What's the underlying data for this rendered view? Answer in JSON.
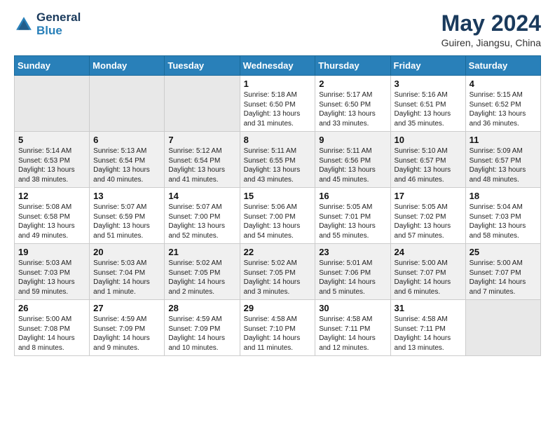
{
  "header": {
    "logo_line1": "General",
    "logo_line2": "Blue",
    "month": "May 2024",
    "location": "Guiren, Jiangsu, China"
  },
  "days_of_week": [
    "Sunday",
    "Monday",
    "Tuesday",
    "Wednesday",
    "Thursday",
    "Friday",
    "Saturday"
  ],
  "weeks": [
    [
      {
        "num": "",
        "info": "",
        "empty": true
      },
      {
        "num": "",
        "info": "",
        "empty": true
      },
      {
        "num": "",
        "info": "",
        "empty": true
      },
      {
        "num": "1",
        "info": "Sunrise: 5:18 AM\nSunset: 6:50 PM\nDaylight: 13 hours\nand 31 minutes.",
        "empty": false
      },
      {
        "num": "2",
        "info": "Sunrise: 5:17 AM\nSunset: 6:50 PM\nDaylight: 13 hours\nand 33 minutes.",
        "empty": false
      },
      {
        "num": "3",
        "info": "Sunrise: 5:16 AM\nSunset: 6:51 PM\nDaylight: 13 hours\nand 35 minutes.",
        "empty": false
      },
      {
        "num": "4",
        "info": "Sunrise: 5:15 AM\nSunset: 6:52 PM\nDaylight: 13 hours\nand 36 minutes.",
        "empty": false
      }
    ],
    [
      {
        "num": "5",
        "info": "Sunrise: 5:14 AM\nSunset: 6:53 PM\nDaylight: 13 hours\nand 38 minutes.",
        "empty": false
      },
      {
        "num": "6",
        "info": "Sunrise: 5:13 AM\nSunset: 6:54 PM\nDaylight: 13 hours\nand 40 minutes.",
        "empty": false
      },
      {
        "num": "7",
        "info": "Sunrise: 5:12 AM\nSunset: 6:54 PM\nDaylight: 13 hours\nand 41 minutes.",
        "empty": false
      },
      {
        "num": "8",
        "info": "Sunrise: 5:11 AM\nSunset: 6:55 PM\nDaylight: 13 hours\nand 43 minutes.",
        "empty": false
      },
      {
        "num": "9",
        "info": "Sunrise: 5:11 AM\nSunset: 6:56 PM\nDaylight: 13 hours\nand 45 minutes.",
        "empty": false
      },
      {
        "num": "10",
        "info": "Sunrise: 5:10 AM\nSunset: 6:57 PM\nDaylight: 13 hours\nand 46 minutes.",
        "empty": false
      },
      {
        "num": "11",
        "info": "Sunrise: 5:09 AM\nSunset: 6:57 PM\nDaylight: 13 hours\nand 48 minutes.",
        "empty": false
      }
    ],
    [
      {
        "num": "12",
        "info": "Sunrise: 5:08 AM\nSunset: 6:58 PM\nDaylight: 13 hours\nand 49 minutes.",
        "empty": false
      },
      {
        "num": "13",
        "info": "Sunrise: 5:07 AM\nSunset: 6:59 PM\nDaylight: 13 hours\nand 51 minutes.",
        "empty": false
      },
      {
        "num": "14",
        "info": "Sunrise: 5:07 AM\nSunset: 7:00 PM\nDaylight: 13 hours\nand 52 minutes.",
        "empty": false
      },
      {
        "num": "15",
        "info": "Sunrise: 5:06 AM\nSunset: 7:00 PM\nDaylight: 13 hours\nand 54 minutes.",
        "empty": false
      },
      {
        "num": "16",
        "info": "Sunrise: 5:05 AM\nSunset: 7:01 PM\nDaylight: 13 hours\nand 55 minutes.",
        "empty": false
      },
      {
        "num": "17",
        "info": "Sunrise: 5:05 AM\nSunset: 7:02 PM\nDaylight: 13 hours\nand 57 minutes.",
        "empty": false
      },
      {
        "num": "18",
        "info": "Sunrise: 5:04 AM\nSunset: 7:03 PM\nDaylight: 13 hours\nand 58 minutes.",
        "empty": false
      }
    ],
    [
      {
        "num": "19",
        "info": "Sunrise: 5:03 AM\nSunset: 7:03 PM\nDaylight: 13 hours\nand 59 minutes.",
        "empty": false
      },
      {
        "num": "20",
        "info": "Sunrise: 5:03 AM\nSunset: 7:04 PM\nDaylight: 14 hours\nand 1 minute.",
        "empty": false
      },
      {
        "num": "21",
        "info": "Sunrise: 5:02 AM\nSunset: 7:05 PM\nDaylight: 14 hours\nand 2 minutes.",
        "empty": false
      },
      {
        "num": "22",
        "info": "Sunrise: 5:02 AM\nSunset: 7:05 PM\nDaylight: 14 hours\nand 3 minutes.",
        "empty": false
      },
      {
        "num": "23",
        "info": "Sunrise: 5:01 AM\nSunset: 7:06 PM\nDaylight: 14 hours\nand 5 minutes.",
        "empty": false
      },
      {
        "num": "24",
        "info": "Sunrise: 5:00 AM\nSunset: 7:07 PM\nDaylight: 14 hours\nand 6 minutes.",
        "empty": false
      },
      {
        "num": "25",
        "info": "Sunrise: 5:00 AM\nSunset: 7:07 PM\nDaylight: 14 hours\nand 7 minutes.",
        "empty": false
      }
    ],
    [
      {
        "num": "26",
        "info": "Sunrise: 5:00 AM\nSunset: 7:08 PM\nDaylight: 14 hours\nand 8 minutes.",
        "empty": false
      },
      {
        "num": "27",
        "info": "Sunrise: 4:59 AM\nSunset: 7:09 PM\nDaylight: 14 hours\nand 9 minutes.",
        "empty": false
      },
      {
        "num": "28",
        "info": "Sunrise: 4:59 AM\nSunset: 7:09 PM\nDaylight: 14 hours\nand 10 minutes.",
        "empty": false
      },
      {
        "num": "29",
        "info": "Sunrise: 4:58 AM\nSunset: 7:10 PM\nDaylight: 14 hours\nand 11 minutes.",
        "empty": false
      },
      {
        "num": "30",
        "info": "Sunrise: 4:58 AM\nSunset: 7:11 PM\nDaylight: 14 hours\nand 12 minutes.",
        "empty": false
      },
      {
        "num": "31",
        "info": "Sunrise: 4:58 AM\nSunset: 7:11 PM\nDaylight: 14 hours\nand 13 minutes.",
        "empty": false
      },
      {
        "num": "",
        "info": "",
        "empty": true
      }
    ]
  ]
}
